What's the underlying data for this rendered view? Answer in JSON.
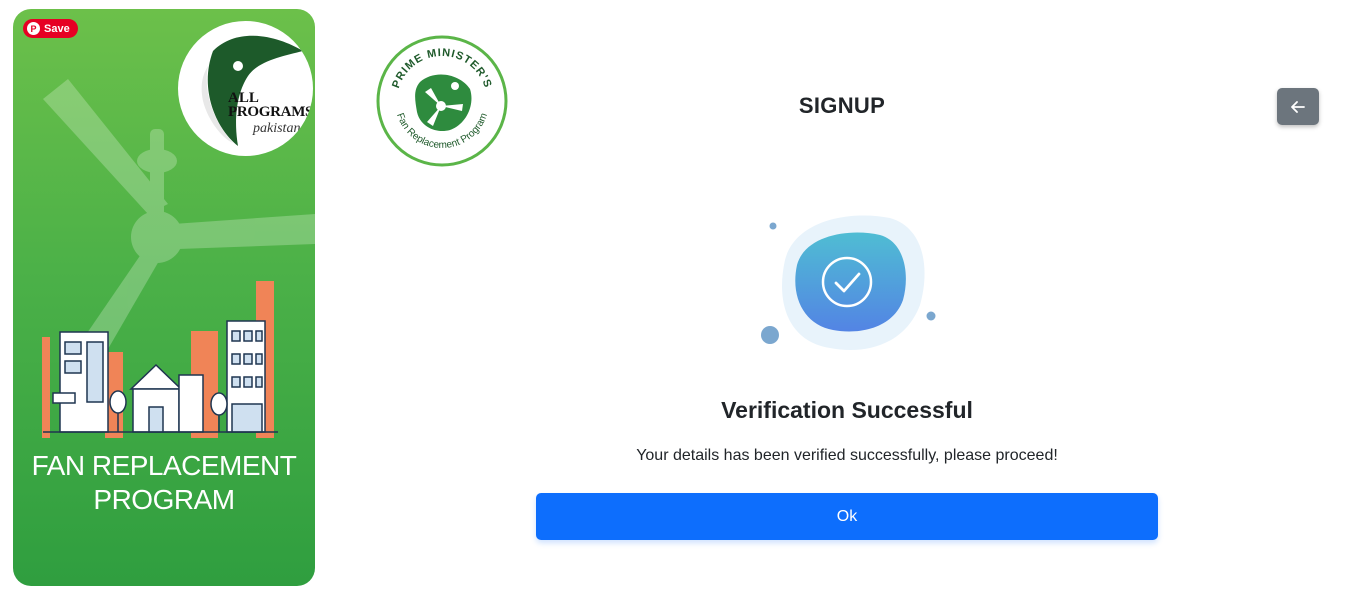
{
  "promo": {
    "save_label": "Save",
    "pinterest_glyph": "P",
    "badge_line1": "ALL",
    "badge_line2": "PROGRAMS",
    "badge_line3": "pakistan",
    "title_line1": "FAN REPLACEMENT",
    "title_line2": "PROGRAM"
  },
  "header": {
    "logo_top_text": "PRIME MINISTER'S",
    "logo_bottom_text": "Fan Replacement Program",
    "title": "SIGNUP",
    "back_icon": "arrow-left-icon"
  },
  "verification": {
    "icon": "check-circle-icon",
    "title": "Verification Successful",
    "message": "Your details has been verified successfully, please proceed!",
    "ok_label": "Ok"
  },
  "colors": {
    "primary": "#0d6efd",
    "secondary": "#6c757d",
    "promo_green": "#4cb148",
    "pinterest_red": "#e60023"
  }
}
